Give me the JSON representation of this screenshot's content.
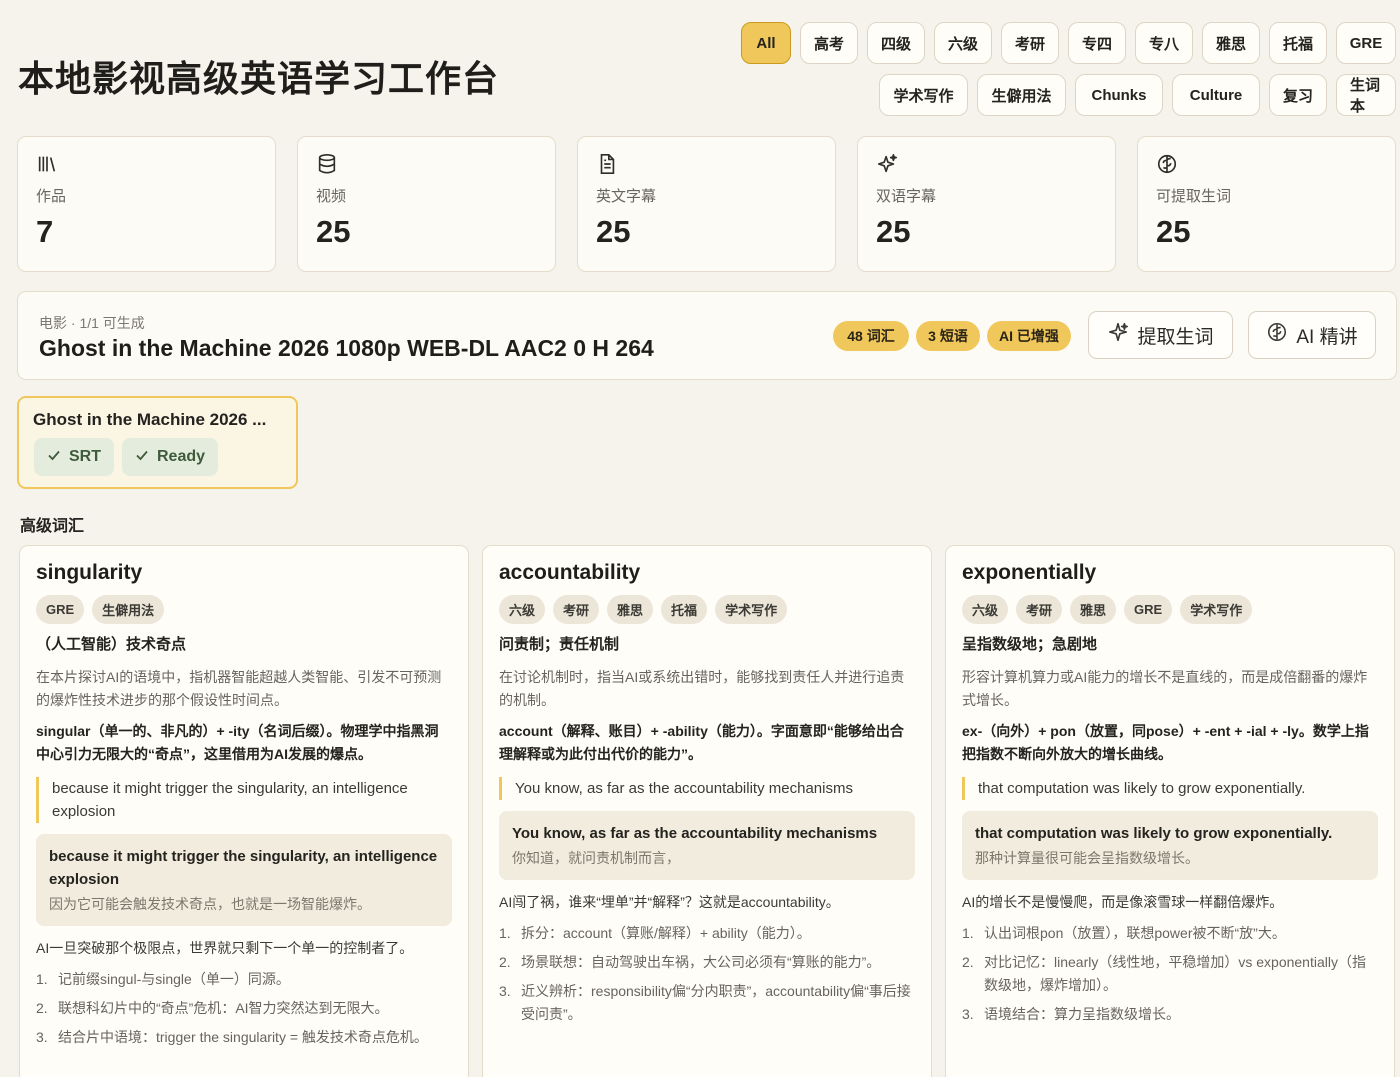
{
  "app": {
    "title": "本地影视高级英语学习工作台"
  },
  "filters": {
    "row1": [
      "All",
      "高考",
      "四级",
      "六级",
      "考研",
      "专四",
      "专八",
      "雅思",
      "托福",
      "GRE"
    ],
    "row2": [
      "学术写作",
      "生僻用法",
      "Chunks",
      "Culture",
      "复习",
      "生词本"
    ],
    "active": "All"
  },
  "stats": [
    {
      "label": "作品",
      "value": "7",
      "icon": "library-icon"
    },
    {
      "label": "视频",
      "value": "25",
      "icon": "database-icon"
    },
    {
      "label": "英文字幕",
      "value": "25",
      "icon": "document-icon"
    },
    {
      "label": "双语字幕",
      "value": "25",
      "icon": "sparkles-icon"
    },
    {
      "label": "可提取生词",
      "value": "25",
      "icon": "brain-icon"
    }
  ],
  "work": {
    "meta": "电影 · 1/1 可生成",
    "title": "Ghost in the Machine 2026 1080p WEB-DL AAC2 0 H 264",
    "badges": [
      "48 词汇",
      "3 短语",
      "AI 已增强"
    ],
    "extract_button": "提取生词",
    "ai_button": "AI 精讲"
  },
  "video": {
    "title": "Ghost in the Machine 2026 ...",
    "tags": [
      "SRT",
      "Ready"
    ]
  },
  "section_title": "高级词汇",
  "cards": [
    {
      "word": "singularity",
      "tags": [
        "GRE",
        "生僻用法"
      ],
      "meaning": "（人工智能）技术奇点",
      "explain": "在本片探讨AI的语境中，指机器智能超越人类智能、引发不可预测的爆炸性技术进步的那个假设性时间点。",
      "etymology": "singular（单一的、非凡的）+ -ity（名词后缀）。物理学中指黑洞中心引力无限大的“奇点”，这里借用为AI发展的爆点。",
      "quote": "because it might trigger the singularity, an intelligence explosion",
      "example_en": "because it might trigger the singularity, an intelligence explosion",
      "example_zh": "因为它可能会触发技术奇点，也就是一场智能爆炸。",
      "story": "AI一旦突破那个极限点，世界就只剩下一个单一的控制者了。",
      "steps": [
        "记前缀singul-与single（单一）同源。",
        "联想科幻片中的“奇点”危机：AI智力突然达到无限大。",
        "结合片中语境：trigger the singularity = 触发技术奇点危机。"
      ]
    },
    {
      "word": "accountability",
      "tags": [
        "六级",
        "考研",
        "雅思",
        "托福",
        "学术写作"
      ],
      "meaning": "问责制；责任机制",
      "explain": "在讨论机制时，指当AI或系统出错时，能够找到责任人并进行追责的机制。",
      "etymology": "account（解释、账目）+ -ability（能力）。字面意即“能够给出合理解释或为此付出代价的能力”。",
      "quote": "You know, as far as the accountability mechanisms",
      "example_en": "You know, as far as the accountability mechanisms",
      "example_zh": "你知道，就问责机制而言，",
      "story": "AI闯了祸，谁来“埋单”并“解释”？这就是accountability。",
      "steps": [
        "拆分：account（算账/解释）+ ability（能力）。",
        "场景联想：自动驾驶出车祸，大公司必须有“算账的能力”。",
        "近义辨析：responsibility偏“分内职责”，accountability偏“事后接受问责”。"
      ]
    },
    {
      "word": "exponentially",
      "tags": [
        "六级",
        "考研",
        "雅思",
        "GRE",
        "学术写作"
      ],
      "meaning": "呈指数级地；急剧地",
      "explain": "形容计算机算力或AI能力的增长不是直线的，而是成倍翻番的爆炸式增长。",
      "etymology": "ex-（向外）+ pon（放置，同pose）+ -ent + -ial + -ly。数学上指把指数不断向外放大的增长曲线。",
      "quote": "that computation was likely to grow exponentially.",
      "example_en": "that computation was likely to grow exponentially.",
      "example_zh": "那种计算量很可能会呈指数级增长。",
      "story": "AI的增长不是慢慢爬，而是像滚雪球一样翻倍爆炸。",
      "steps": [
        "认出词根pon（放置），联想power被不断“放”大。",
        "对比记忆：linearly（线性地，平稳增加）vs exponentially（指数级地，爆炸增加）。",
        "语境结合：算力呈指数级增长。"
      ]
    }
  ]
}
